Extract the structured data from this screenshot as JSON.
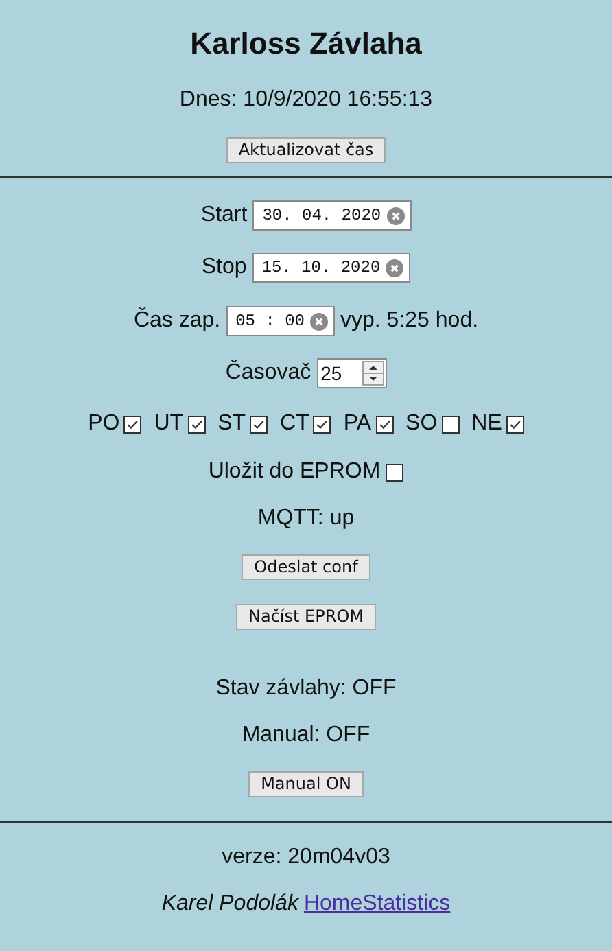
{
  "title": "Karloss Závlaha",
  "today": "Dnes: 10/9/2020 16:55:13",
  "update_button": "Aktualizovat čas",
  "start": {
    "label": "Start",
    "value": "30. 04. 2020"
  },
  "stop": {
    "label": "Stop",
    "value": "15. 10. 2020"
  },
  "on_time": {
    "label": "Čas zap.",
    "value": "05 : 00",
    "off_text": "vyp. 5:25 hod."
  },
  "timer": {
    "label": "Časovač",
    "value": "25"
  },
  "days": [
    {
      "label": "PO",
      "checked": true
    },
    {
      "label": "UT",
      "checked": true
    },
    {
      "label": "ST",
      "checked": true
    },
    {
      "label": "CT",
      "checked": true
    },
    {
      "label": "PA",
      "checked": true
    },
    {
      "label": "SO",
      "checked": false
    },
    {
      "label": "NE",
      "checked": true
    }
  ],
  "save_eprom": {
    "label": "Uložit do EPROM",
    "checked": false
  },
  "mqtt": "MQTT: up",
  "send_button": "Odeslat conf",
  "load_button": "Načíst EPROM",
  "irrigation_state": "Stav závlahy: OFF",
  "manual_state": "Manual: OFF",
  "manual_button": "Manual ON",
  "version": "verze: 20m04v03",
  "author": "Karel Podolák",
  "link": "HomeStatistics"
}
